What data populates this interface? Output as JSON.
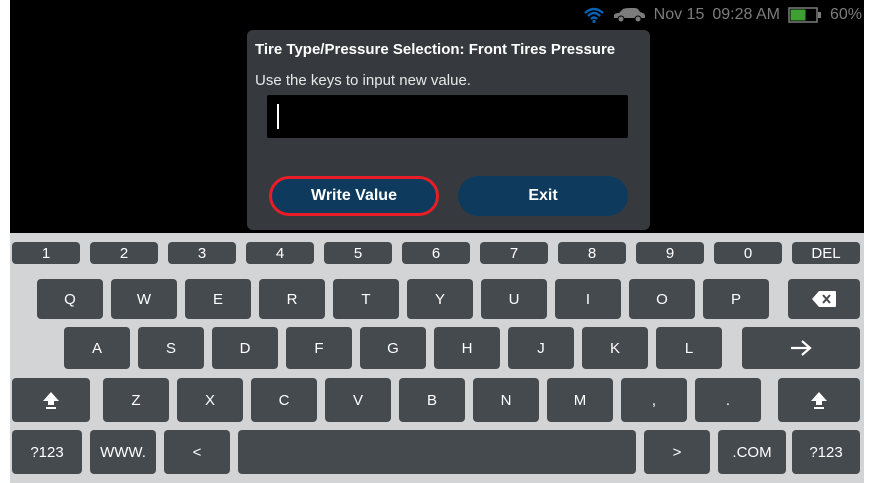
{
  "status_bar": {
    "date": "Nov 15",
    "time": "09:28 AM",
    "battery": "60%",
    "battery_level": 0.6,
    "wifi_icon": "wifi-icon",
    "car_icon": "car-icon"
  },
  "dialog": {
    "title": "Tire Type/Pressure Selection: Front Tires Pressure",
    "message": "Use the keys to input new value.",
    "input_value": "",
    "write_button": "Write Value",
    "exit_button": "Exit",
    "accent_color": "#e81d25",
    "button_color": "#0e3a5e"
  },
  "keyboard": {
    "row1": [
      "1",
      "2",
      "3",
      "4",
      "5",
      "6",
      "7",
      "8",
      "9",
      "0",
      "DEL"
    ],
    "row2": [
      "Q",
      "W",
      "E",
      "R",
      "T",
      "Y",
      "U",
      "I",
      "O",
      "P"
    ],
    "row3": [
      "A",
      "S",
      "D",
      "F",
      "G",
      "H",
      "J",
      "K",
      "L"
    ],
    "row4": [
      "Z",
      "X",
      "C",
      "V",
      "B",
      "N",
      "M",
      ",",
      "."
    ],
    "row5": {
      "left_mode": "?123",
      "www": "WWW.",
      "less": "<",
      "greater": ">",
      "com": ".COM",
      "right_mode": "?123"
    },
    "icons": {
      "backspace": "backspace-icon",
      "enter": "arrow-right-icon",
      "shift": "shift-icon"
    }
  }
}
